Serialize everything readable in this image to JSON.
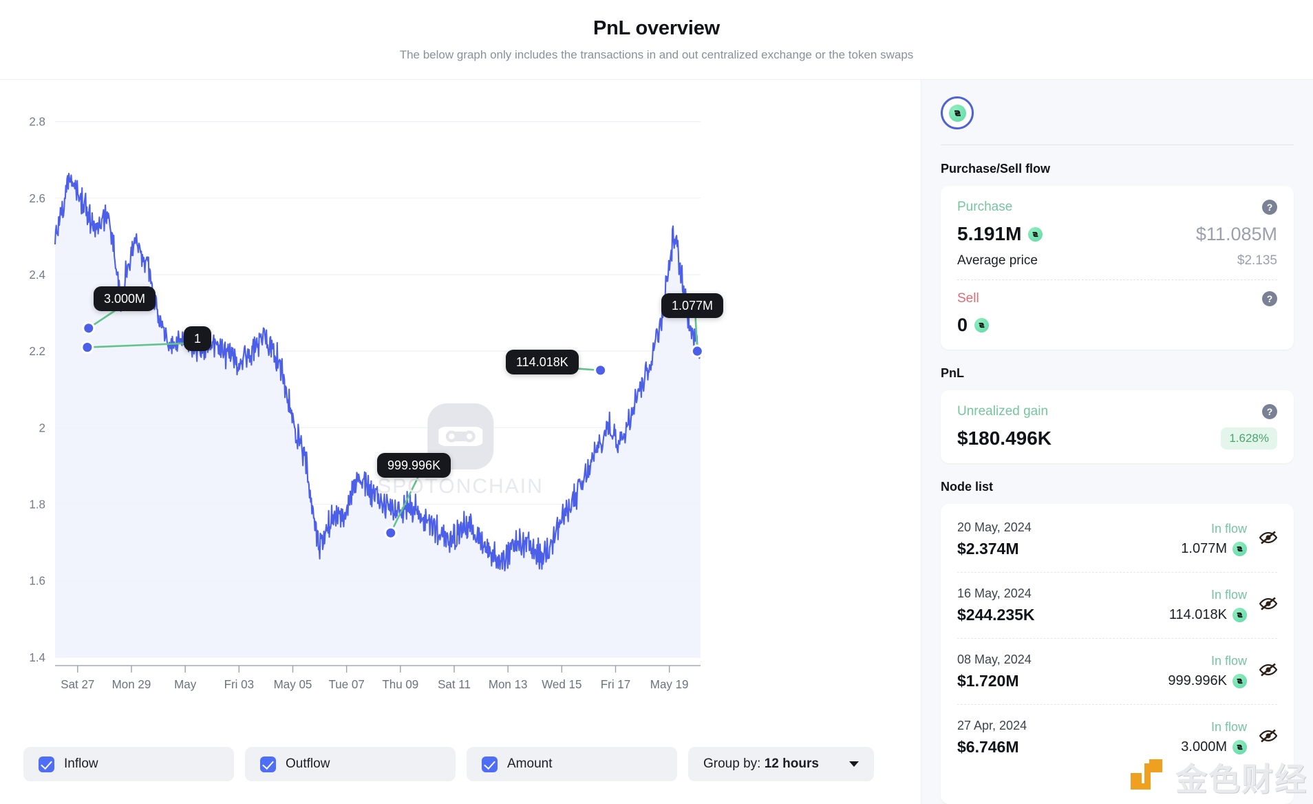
{
  "header": {
    "title": "PnL overview",
    "subtitle": "The below graph only includes the transactions in and out centralized exchange or the token swaps"
  },
  "chart_data": {
    "type": "line",
    "title": "PnL overview",
    "xlabel": "",
    "ylabel": "",
    "ylim": [
      1.4,
      2.8
    ],
    "yticks": [
      "2.8",
      "2.6",
      "2.4",
      "2.2",
      "2",
      "1.8",
      "1.6",
      "1.4"
    ],
    "xticks": [
      "Sat 27",
      "Mon 29",
      "May",
      "Fri 03",
      "May 05",
      "Tue 07",
      "Thu 09",
      "Sat 11",
      "Mon 13",
      "Wed 15",
      "Fri 17",
      "May 19"
    ],
    "grid": true,
    "legend": "none",
    "line_color": "#4c5fe8",
    "fill_color": "#eef1fd",
    "series": [
      {
        "name": "Price",
        "x": [
          "Apr 26",
          "Apr 26",
          "Apr 27",
          "Apr 27",
          "Apr 28",
          "Apr 28",
          "Apr 29",
          "Apr 29",
          "Apr 30",
          "Apr 30",
          "May 01",
          "May 01",
          "May 02",
          "May 02",
          "May 03",
          "May 03",
          "May 04",
          "May 04",
          "May 05",
          "May 05",
          "May 06",
          "May 06",
          "May 07",
          "May 07",
          "May 08",
          "May 08",
          "May 09",
          "May 09",
          "May 10",
          "May 10",
          "May 11",
          "May 11",
          "May 12",
          "May 12",
          "May 13",
          "May 13",
          "May 14",
          "May 14",
          "May 15",
          "May 15",
          "May 16",
          "May 16",
          "May 17",
          "May 17",
          "May 18",
          "May 18",
          "May 19",
          "May 19",
          "May 20",
          "May 20"
        ],
        "values": [
          2.48,
          2.66,
          2.6,
          2.52,
          2.57,
          2.34,
          2.49,
          2.43,
          2.26,
          2.21,
          2.24,
          2.2,
          2.22,
          2.19,
          2.17,
          2.2,
          2.24,
          2.18,
          2.02,
          1.92,
          1.69,
          1.76,
          1.78,
          1.88,
          1.83,
          1.8,
          1.78,
          1.8,
          1.76,
          1.73,
          1.7,
          1.75,
          1.72,
          1.68,
          1.64,
          1.7,
          1.69,
          1.66,
          1.73,
          1.79,
          1.85,
          1.93,
          2.0,
          1.96,
          2.08,
          2.15,
          2.28,
          2.51,
          2.3,
          2.19
        ]
      }
    ],
    "annotations": [
      {
        "label": "3.000M",
        "anchor_x_frac": 0.052,
        "anchor_y_value": 2.26
      },
      {
        "label": "1",
        "anchor_x_frac": 0.05,
        "anchor_y_value": 2.21
      },
      {
        "label": "999.996K",
        "anchor_x_frac": 0.52,
        "anchor_y_value": 1.725
      },
      {
        "label": "114.018K",
        "anchor_x_frac": 0.845,
        "anchor_y_value": 2.15
      },
      {
        "label": "1.077M",
        "anchor_x_frac": 0.995,
        "anchor_y_value": 2.2
      }
    ]
  },
  "controls": {
    "inflow_label": "Inflow",
    "outflow_label": "Outflow",
    "amount_label": "Amount",
    "group_by_prefix": "Group by: ",
    "group_by_value": "12 hours"
  },
  "panel": {
    "flow_section_title": "Purchase/Sell flow",
    "purchase": {
      "label": "Purchase",
      "amount": "5.191M",
      "usd": "$11.085M",
      "avg_price_label": "Average price",
      "avg_price_value": "$2.135"
    },
    "sell": {
      "label": "Sell",
      "amount": "0"
    },
    "pnl_section_title": "PnL",
    "pnl": {
      "label": "Unrealized gain",
      "value": "$180.496K",
      "percent": "1.628%"
    },
    "node_section_title": "Node list",
    "nodes": [
      {
        "date": "20 May, 2024",
        "usd": "$2.374M",
        "flow": "In flow",
        "qty": "1.077M"
      },
      {
        "date": "16 May, 2024",
        "usd": "$244.235K",
        "flow": "In flow",
        "qty": "114.018K"
      },
      {
        "date": "08 May, 2024",
        "usd": "$1.720M",
        "flow": "In flow",
        "qty": "999.996K"
      },
      {
        "date": "27 Apr, 2024",
        "usd": "$6.746M",
        "flow": "In flow",
        "qty": "3.000M"
      }
    ]
  },
  "watermarks": {
    "chart": "SPOTONCHAIN",
    "corner": "金色财经"
  }
}
